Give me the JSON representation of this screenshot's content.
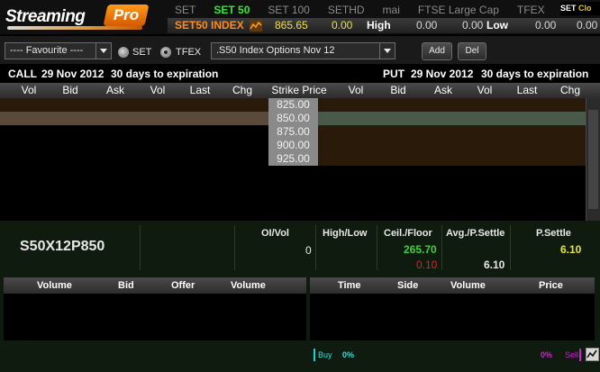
{
  "brand": {
    "name_main": "Streaming",
    "name_badge": "Pro"
  },
  "index_tabs": [
    {
      "label": "SET",
      "active": false
    },
    {
      "label": "SET 50",
      "active": true
    },
    {
      "label": "SET 100",
      "active": false
    },
    {
      "label": "SETHD",
      "active": false
    },
    {
      "label": "mai",
      "active": false
    },
    {
      "label": "FTSE Large Cap",
      "active": false
    },
    {
      "label": "TFEX",
      "active": false
    }
  ],
  "market_status": {
    "market": "SET",
    "status": "Clo"
  },
  "ticker": {
    "index_name": "SET50 INDEX",
    "last": "865.65",
    "change": "0.00",
    "high_label": "High",
    "high_a": "0.00",
    "high_b": "0.00",
    "low_label": "Low",
    "low_a": "0.00",
    "low_b": "0.00"
  },
  "controls": {
    "favourite_select": "---- Favourite ----",
    "radio_set": "SET",
    "radio_tfex": "TFEX",
    "radio_selected": "TFEX",
    "series_select": ".S50 Index Options Nov 12",
    "add_label": "Add",
    "del_label": "Del"
  },
  "call_header": {
    "label": "CALL",
    "date": "29 Nov 2012",
    "expiry": "30 days to expiration"
  },
  "put_header": {
    "label": "PUT",
    "date": "29 Nov 2012",
    "expiry": "30 days to expiration"
  },
  "columns": {
    "call": [
      "Vol",
      "Bid",
      "Ask",
      "Vol",
      "Last",
      "Chg"
    ],
    "strike": "Strike Price",
    "put": [
      "Vol",
      "Bid",
      "Ask",
      "Vol",
      "Last",
      "Chg"
    ]
  },
  "strikes": [
    "825.00",
    "850.00",
    "875.00",
    "900.00",
    "925.00"
  ],
  "selected_strike_index": 1,
  "detail": {
    "symbol": "S50X12P850",
    "oi_vol_label": "OI/Vol",
    "oi_vol_value": "0",
    "high_low_label": "High/Low",
    "ceil_floor_label": "Ceil./Floor",
    "ceil_value": "265.70",
    "floor_value": "0.10",
    "avg_settle_label": "Avg./P.Settle",
    "avg_settle_value": "6.10",
    "psettle_label": "P.Settle",
    "psettle_value": "6.10"
  },
  "bidoffer_table": {
    "columns": [
      "Volume",
      "Bid",
      "Offer",
      "Volume"
    ]
  },
  "trade_table": {
    "columns": [
      "Time",
      "Side",
      "Volume",
      "Price"
    ]
  },
  "footer": {
    "buy_label": "Buy",
    "buy_pct": "0%",
    "sell_pct": "0%",
    "sell_label": "Sell"
  },
  "colors": {
    "accent_green": "#35e835",
    "accent_orange": "#ff8c1a",
    "ceil_green": "#3cd23c",
    "floor_red": "#e02020",
    "settle_yellow": "#e6e62a",
    "row_selected": "#4a5a4a",
    "row_brown": "#2a1a0a"
  }
}
